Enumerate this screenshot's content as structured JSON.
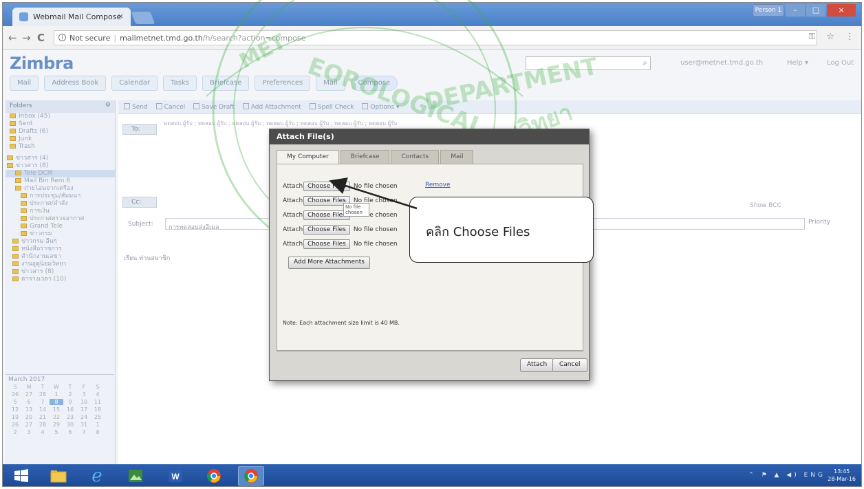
{
  "browser": {
    "tab_title": "Webmail Mail Compose",
    "tab_close": "×",
    "nav_back": "←",
    "nav_forward": "→",
    "nav_reload": "C",
    "security_label": "Not secure",
    "url_host": "mailmetnet.tmd.go.th",
    "url_path": "/h/search?action=compose",
    "user_button": "Person 1",
    "min_glyph": "–",
    "max_glyph": "□",
    "close_glyph": "×",
    "key_icon": "⚿",
    "star_icon": "☆",
    "menu_icon": "⋮"
  },
  "zimbra": {
    "logo": "Zimbra",
    "search_placeholder": "",
    "user_email": "user@metnet.tmd.go.th",
    "help": "Help ▾",
    "logout": "Log Out",
    "app_tabs": [
      "Mail",
      "Address Book",
      "Calendar",
      "Tasks",
      "Briefcase",
      "Preferences",
      "Mail",
      "Compose"
    ]
  },
  "sidebar": {
    "header": "Folders",
    "folders": [
      "Inbox (45)",
      "Sent",
      "Drafts (6)",
      "Junk",
      "Trash",
      "ข่าวสาร (4)",
      "ข่าวสาร (8)",
      "Tele DCM",
      "Mail Bin Rem 6",
      "ถ่ายโอนจากเครื่อง",
      "การประชุม/สัมมนา",
      "ประกาศ/คำสั่ง",
      "การเงิน",
      "ประกาศตรวจอากาศ",
      "Grand Tele",
      "ข่าวกรม",
      "ข่าวกรม อื่นๆ",
      "หนังสือราชการ",
      "สำนักงานเลขา",
      "งานอุตุนิยมวิทยา",
      "ข่าวสาร (8)",
      "ตารางเวลา (10)"
    ],
    "calendar_month": "March 2017",
    "calendar_days": [
      "S",
      "M",
      "T",
      "W",
      "T",
      "F",
      "S",
      "26",
      "27",
      "28",
      "1",
      "2",
      "3",
      "4",
      "5",
      "6",
      "7",
      "8",
      "9",
      "10",
      "11",
      "12",
      "13",
      "14",
      "15",
      "16",
      "17",
      "18",
      "19",
      "20",
      "21",
      "22",
      "23",
      "24",
      "25",
      "26",
      "27",
      "28",
      "29",
      "30",
      "31",
      "1",
      "2",
      "3",
      "4",
      "5",
      "6",
      "7",
      "8"
    ]
  },
  "compose": {
    "toolbar": [
      "Send",
      "Cancel",
      "Save Draft",
      "Add Attachment",
      "Spell Check",
      "Options ▾"
    ],
    "to_label": "To:",
    "cc_label": "Cc:",
    "subject_label": "Subject:",
    "subject_value": "การทดสอบส่งอีเมล",
    "priority": "Priority",
    "show_bcc": "Show BCC",
    "body_text": "เรียน ท่านสมาชิก"
  },
  "dialog": {
    "title": "Attach File(s)",
    "tabs": [
      "My Computer",
      "Briefcase",
      "Contacts",
      "Mail"
    ],
    "attach_label": "Attach:",
    "choose_label": "Choose Files",
    "no_file": "No file chosen",
    "remove": "Remove",
    "tooltip": "No file chosen",
    "add_more": "Add More Attachments",
    "note": "Note: Each attachment size limit is 40 MB.",
    "attach_button": "Attach",
    "cancel_button": "Cancel"
  },
  "callout": {
    "text": "คลิก Choose Files"
  },
  "taskbar": {
    "clock_time": "13:45",
    "clock_date": "28-Mar-16",
    "tray_lang": "ENG",
    "tray_icons": "⌃ ⚑ ▲ ◀)"
  },
  "colors": {
    "titlebar": "#4a80c8",
    "dialog_title": "#4c4c4c",
    "dialog_bg": "#f4f2ec",
    "watermark": "#3fae3f",
    "taskbar": "#1d4a95"
  }
}
